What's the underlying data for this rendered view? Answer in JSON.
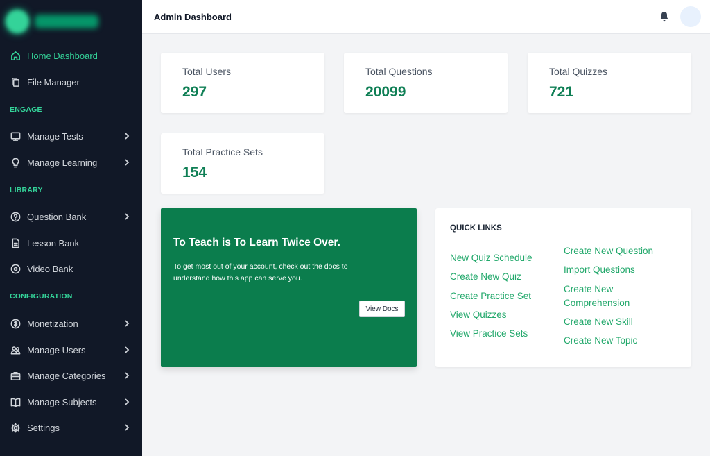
{
  "sidebar": {
    "items": [
      {
        "label": "Home Dashboard",
        "icon": "home-icon"
      },
      {
        "label": "File Manager",
        "icon": "copy-icon"
      },
      {
        "label": "Manage Tests",
        "icon": "monitor-icon"
      },
      {
        "label": "Manage Learning",
        "icon": "lightbulb-icon"
      },
      {
        "label": "Question Bank",
        "icon": "question-circle-icon"
      },
      {
        "label": "Lesson Bank",
        "icon": "document-icon"
      },
      {
        "label": "Video Bank",
        "icon": "play-circle-icon"
      },
      {
        "label": "Monetization",
        "icon": "dollar-icon"
      },
      {
        "label": "Manage Users",
        "icon": "users-icon"
      },
      {
        "label": "Manage Categories",
        "icon": "briefcase-icon"
      },
      {
        "label": "Manage Subjects",
        "icon": "book-icon"
      },
      {
        "label": "Settings",
        "icon": "gear-icon"
      }
    ],
    "sections": [
      "ENGAGE",
      "LIBRARY",
      "CONFIGURATION"
    ]
  },
  "header": {
    "title": "Admin Dashboard"
  },
  "stats": [
    {
      "label": "Total Users",
      "value": "297"
    },
    {
      "label": "Total Questions",
      "value": "20099"
    },
    {
      "label": "Total Quizzes",
      "value": "721"
    },
    {
      "label": "Total Practice Sets",
      "value": "154"
    }
  ],
  "promo": {
    "title": "To Teach is To Learn Twice Over.",
    "text": "To get most out of your account, check out the docs to understand how this app can serve you.",
    "button": "View Docs"
  },
  "quick_links": {
    "title": "QUICK LINKS",
    "col1": [
      "New Quiz Schedule",
      "Create New Quiz",
      "Create Practice Set",
      "View Quizzes",
      "View Practice Sets"
    ],
    "col2": [
      "Create New Question",
      "Import Questions",
      "Create New Comprehension",
      "Create New Skill",
      "Create New Topic"
    ]
  },
  "colors": {
    "sidebar_bg": "#111827",
    "accent": "#34d399",
    "primary_green": "#0b7d4d",
    "stat_value": "#0f7f55",
    "link": "#22a86b"
  }
}
